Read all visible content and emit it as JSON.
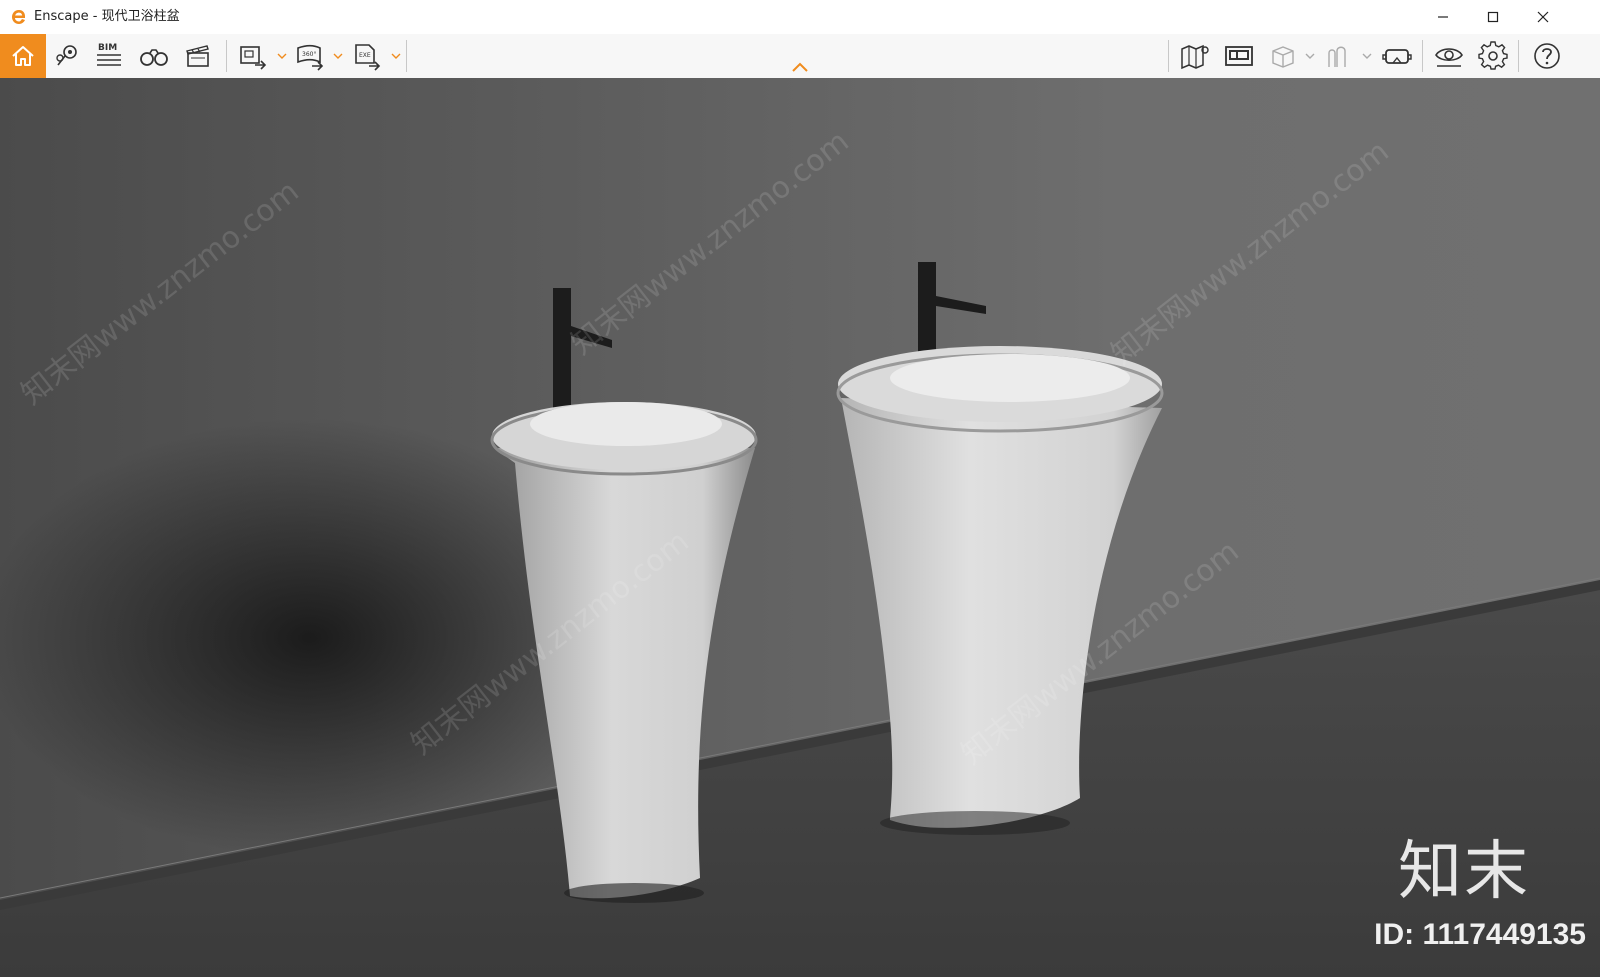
{
  "window": {
    "app_name": "Enscape",
    "separator": " - ",
    "document_title": "现代卫浴柱盆",
    "accent_color": "#f08c1e"
  },
  "toolbar": {
    "left_buttons": [
      {
        "name": "home-icon",
        "label": ""
      },
      {
        "name": "map-pin-icon",
        "label": ""
      },
      {
        "name": "bim-icon",
        "label": "BIM"
      },
      {
        "name": "binoculars-icon",
        "label": ""
      },
      {
        "name": "clapperboard-icon",
        "label": ""
      },
      {
        "name": "export-screenshot-icon",
        "label": ""
      },
      {
        "name": "export-360-icon",
        "label": "360°"
      },
      {
        "name": "export-exe-icon",
        "label": "EXE"
      }
    ],
    "right_buttons": [
      {
        "name": "map-icon"
      },
      {
        "name": "image-panel-icon"
      },
      {
        "name": "cube-icon"
      },
      {
        "name": "people-icon"
      },
      {
        "name": "vr-headset-icon"
      },
      {
        "name": "eye-icon"
      },
      {
        "name": "gear-icon"
      },
      {
        "name": "help-icon"
      }
    ]
  },
  "watermark": {
    "brand": "知末",
    "id_text": "ID: 1117449135",
    "diagonal_text": "知末网www.znzmo.com"
  }
}
